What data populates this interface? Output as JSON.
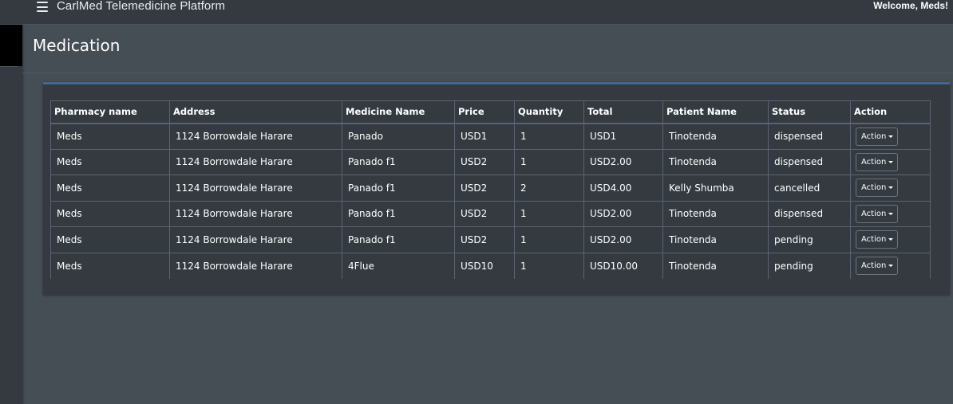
{
  "navbar": {
    "menu_icon": "hamburger-icon",
    "brand": "CarlMed Telemedicine Platform",
    "welcome": "Welcome, Meds!"
  },
  "page": {
    "title": "Medication"
  },
  "table": {
    "headers": [
      "Pharmacy name",
      "Address",
      "Medicine Name",
      "Price",
      "Quantity",
      "Total",
      "Patient Name",
      "Status",
      "Action"
    ],
    "rows": [
      {
        "pharmacy": "Meds",
        "address": "1124 Borrowdale Harare",
        "medicine": "Panado",
        "price": "USD1",
        "quantity": "1",
        "total": "USD1",
        "patient": "Tinotenda",
        "status": "dispensed",
        "action": "Action"
      },
      {
        "pharmacy": "Meds",
        "address": "1124 Borrowdale Harare",
        "medicine": "Panado f1",
        "price": "USD2",
        "quantity": "1",
        "total": "USD2.00",
        "patient": "Tinotenda",
        "status": "dispensed",
        "action": "Action"
      },
      {
        "pharmacy": "Meds",
        "address": "1124 Borrowdale Harare",
        "medicine": "Panado f1",
        "price": "USD2",
        "quantity": "2",
        "total": "USD4.00",
        "patient": "Kelly Shumba",
        "status": "cancelled",
        "action": "Action"
      },
      {
        "pharmacy": "Meds",
        "address": "1124 Borrowdale Harare",
        "medicine": "Panado f1",
        "price": "USD2",
        "quantity": "1",
        "total": "USD2.00",
        "patient": "Tinotenda",
        "status": "dispensed",
        "action": "Action"
      },
      {
        "pharmacy": "Meds",
        "address": "1124 Borrowdale Harare",
        "medicine": "Panado f1",
        "price": "USD2",
        "quantity": "1",
        "total": "USD2.00",
        "patient": "Tinotenda",
        "status": "pending",
        "action": "Action"
      },
      {
        "pharmacy": "Meds",
        "address": "1124 Borrowdale Harare",
        "medicine": "4Flue",
        "price": "USD10",
        "quantity": "1",
        "total": "USD10.00",
        "patient": "Tinotenda",
        "status": "pending",
        "action": "Action"
      }
    ]
  },
  "colors": {
    "content_bg": "#454d55",
    "navbar_bg": "#343a40",
    "card_bg": "#343a40",
    "card_accent": "#3f6791",
    "border": "#5a6470"
  }
}
